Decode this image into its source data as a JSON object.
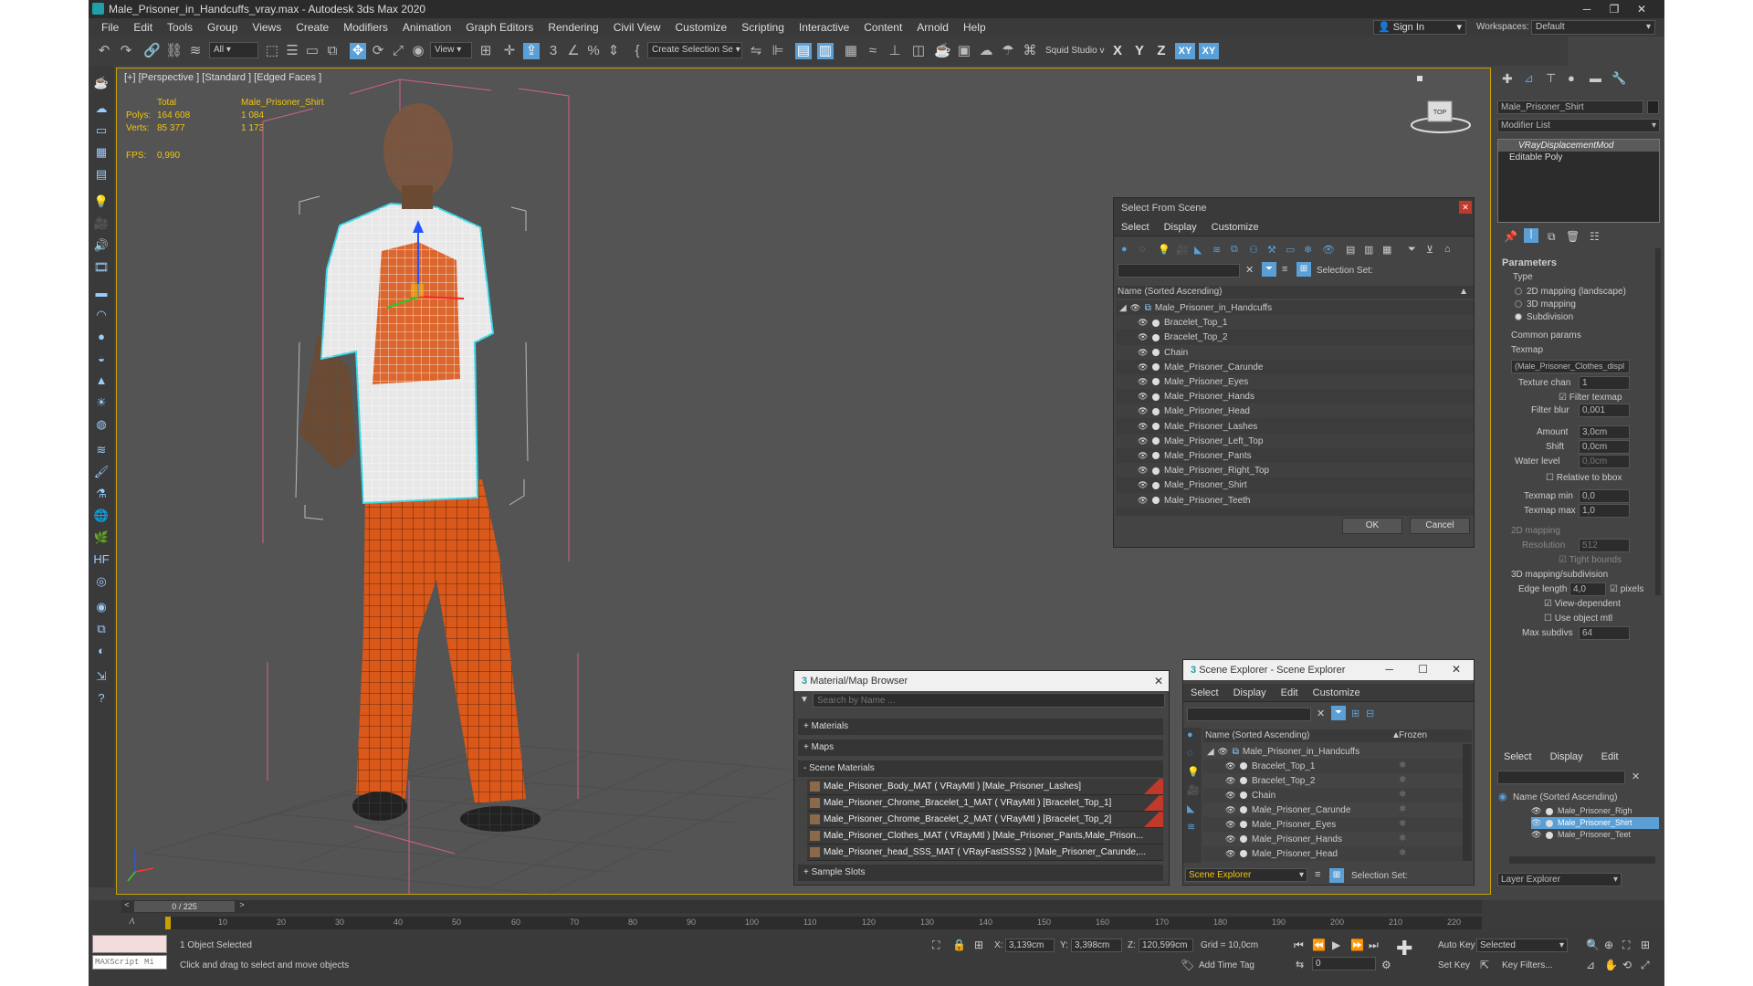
{
  "window": {
    "title": "Male_Prisoner_in_Handcuffs_vray.max - Autodesk 3ds Max 2020",
    "min": "─",
    "restore": "❐",
    "close": "✕"
  },
  "menu": [
    "File",
    "Edit",
    "Tools",
    "Group",
    "Views",
    "Create",
    "Modifiers",
    "Animation",
    "Graph Editors",
    "Rendering",
    "Civil View",
    "Customize",
    "Scripting",
    "Interactive",
    "Content",
    "Arnold",
    "Help"
  ],
  "signin": {
    "label": "Sign In",
    "workspaces_label": "Workspaces:",
    "workspace": "Default"
  },
  "toolbar": {
    "filter": "All",
    "view": "View",
    "selection_set": "Create Selection Se",
    "squid": "Squid Studio v",
    "axis_x": "X",
    "axis_y": "Y",
    "axis_z": "Z",
    "axis_xy": "XY",
    "axis_xy2": "XY"
  },
  "viewport": {
    "label": "[+] [Perspective ] [Standard ] [Edged Faces ]",
    "stats_total": "Total",
    "stats_obj": "Male_Prisoner_Shirt",
    "polys_label": "Polys:",
    "polys_total": "164 608",
    "polys_obj": "1 084",
    "verts_label": "Verts:",
    "verts_total": "85 377",
    "verts_obj": "1 173",
    "fps_label": "FPS:",
    "fps": "0,990"
  },
  "command_panel": {
    "object_name": "Male_Prisoner_Shirt",
    "modifier_list": "Modifier List",
    "stack": [
      "VRayDisplacementMod",
      "Editable Poly"
    ],
    "params_title": "Parameters",
    "type_label": "Type",
    "type_options": [
      "2D mapping (landscape)",
      "3D mapping",
      "Subdivision"
    ],
    "common_params": "Common params",
    "texmap_label": "Texmap",
    "texmap_value": "(Male_Prisoner_Clothes_displ",
    "texture_chan_label": "Texture chan",
    "texture_chan": "1",
    "filter_texmap": "Filter texmap",
    "filter_blur_label": "Filter blur",
    "filter_blur": "0,001",
    "amount_label": "Amount",
    "amount": "3,0cm",
    "shift_label": "Shift",
    "shift": "0,0cm",
    "water_label": "Water level",
    "water": "0,0cm",
    "relative_bbox": "Relative to bbox",
    "texmap_min_label": "Texmap min",
    "texmap_min": "0,0",
    "texmap_max_label": "Texmap max",
    "texmap_max": "1,0",
    "mapping2d": "2D mapping",
    "resolution_label": "Resolution",
    "resolution": "512",
    "tight_bounds": "Tight bounds",
    "mapping3d": "3D mapping/subdivision",
    "edge_length_label": "Edge length",
    "edge_length": "4,0",
    "pixels": "pixels",
    "view_dependent": "View-dependent",
    "use_object_mtl": "Use object mtl",
    "max_subdivs_label": "Max subdivs",
    "max_subdivs": "64"
  },
  "mini_explorer": {
    "menu": [
      "Select",
      "Display",
      "Edit"
    ],
    "header": "Name (Sorted Ascending)",
    "rows": [
      "Male_Prisoner_Righ",
      "Male_Prisoner_Shirt",
      "Male_Prisoner_Teet"
    ],
    "footer": "Layer Explorer"
  },
  "select_from_scene": {
    "title": "Select From Scene",
    "menu": [
      "Select",
      "Display",
      "Customize"
    ],
    "selection_set_label": "Selection Set:",
    "header": "Name (Sorted Ascending)",
    "root": "Male_Prisoner_in_Handcuffs",
    "items": [
      "Bracelet_Top_1",
      "Bracelet_Top_2",
      "Chain",
      "Male_Prisoner_Carunde",
      "Male_Prisoner_Eyes",
      "Male_Prisoner_Hands",
      "Male_Prisoner_Head",
      "Male_Prisoner_Lashes",
      "Male_Prisoner_Left_Top",
      "Male_Prisoner_Pants",
      "Male_Prisoner_Right_Top",
      "Male_Prisoner_Shirt",
      "Male_Prisoner_Teeth"
    ],
    "ok": "OK",
    "cancel": "Cancel"
  },
  "material_browser": {
    "title": "Material/Map Browser",
    "search_placeholder": "Search by Name ...",
    "materials": "+ Materials",
    "maps": "+ Maps",
    "scene_materials": "- Scene Materials",
    "items": [
      "Male_Prisoner_Body_MAT ( VRayMtl ) [Male_Prisoner_Lashes]",
      "Male_Prisoner_Chrome_Bracelet_1_MAT ( VRayMtl ) [Bracelet_Top_1]",
      "Male_Prisoner_Chrome_Bracelet_2_MAT ( VRayMtl ) [Bracelet_Top_2]",
      "Male_Prisoner_Clothes_MAT ( VRayMtl ) [Male_Prisoner_Pants,Male_Prison...",
      "Male_Prisoner_head_SSS_MAT ( VRayFastSSS2 ) [Male_Prisoner_Carunde,..."
    ],
    "sample_slots": "+ Sample Slots"
  },
  "scene_explorer": {
    "title": "Scene Explorer - Scene Explorer",
    "menu": [
      "Select",
      "Display",
      "Edit",
      "Customize"
    ],
    "header": "Name (Sorted Ascending)",
    "frozen": "Frozen",
    "root": "Male_Prisoner_in_Handcuffs",
    "items": [
      "Bracelet_Top_1",
      "Bracelet_Top_2",
      "Chain",
      "Male_Prisoner_Carunde",
      "Male_Prisoner_Eyes",
      "Male_Prisoner_Hands",
      "Male_Prisoner_Head"
    ],
    "footer_name": "Scene Explorer",
    "selection_set_label": "Selection Set:"
  },
  "timeline": {
    "frame": "0 / 225",
    "ticks": [
      "10",
      "20",
      "30",
      "40",
      "50",
      "60",
      "70",
      "80",
      "90",
      "100",
      "110",
      "120",
      "130",
      "140",
      "150",
      "160",
      "170",
      "180",
      "190",
      "200",
      "210",
      "220"
    ]
  },
  "status": {
    "maxscript": "MAXScript Mi",
    "selected": "1 Object Selected",
    "hint": "Click and drag to select and move objects",
    "x_label": "X:",
    "x": "3,139cm",
    "y_label": "Y:",
    "y": "3,398cm",
    "z_label": "Z:",
    "z": "120,599cm",
    "grid": "Grid = 10,0cm",
    "add_time_tag": "Add Time Tag",
    "auto_key": "Auto Key",
    "set_key": "Set Key",
    "selected_dd": "Selected",
    "key_filters": "Key Filters...",
    "frame_field": "0"
  },
  "colors": {
    "selection": "#f1c40f",
    "accent": "#5a9fd6",
    "shirt": "#e8e8e8",
    "pants": "#d9581a",
    "wire_select": "#3ad7e6"
  }
}
